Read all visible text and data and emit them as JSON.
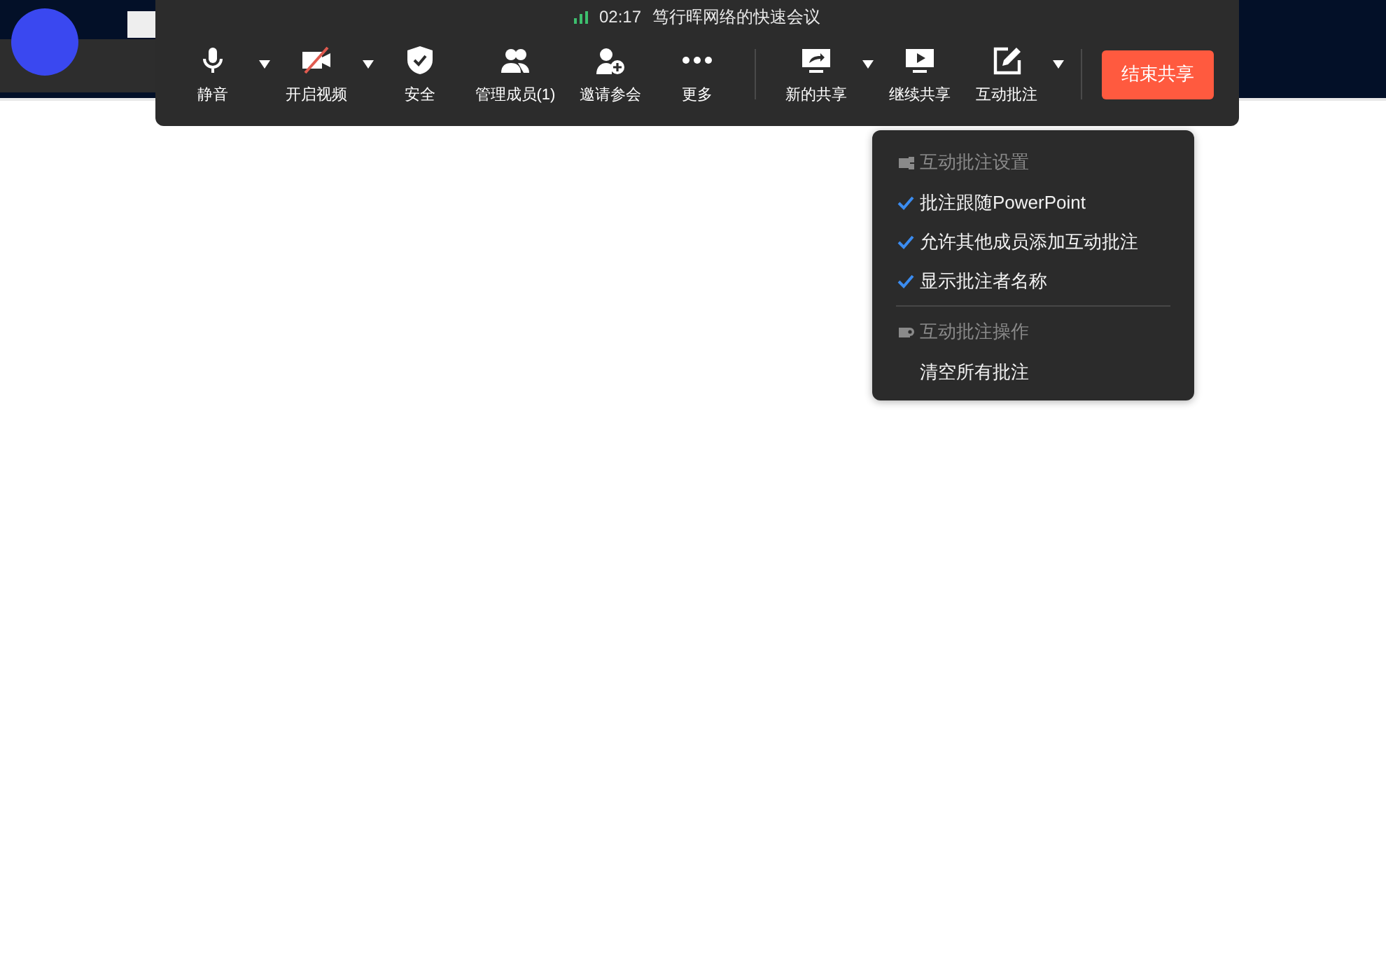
{
  "toolbar": {
    "status": {
      "time": "02:17",
      "title": "笃行晖网络的快速会议"
    },
    "buttons": [
      {
        "kind": "tool",
        "label": "静音",
        "has_menu": true
      },
      {
        "kind": "tool",
        "label": "开启视频",
        "has_menu": true
      },
      {
        "kind": "tool",
        "label": "安全",
        "has_menu": false
      },
      {
        "kind": "tool",
        "label": "管理成员(1)",
        "has_menu": false
      },
      {
        "kind": "tool",
        "label": "邀请参会",
        "has_menu": false
      },
      {
        "kind": "tool",
        "label": "更多",
        "has_menu": false
      },
      {
        "kind": "divider"
      },
      {
        "kind": "tool",
        "label": "新的共享",
        "has_menu": true
      },
      {
        "kind": "tool",
        "label": "继续共享",
        "has_menu": false
      },
      {
        "kind": "tool",
        "label": "互动批注",
        "has_menu": true
      },
      {
        "kind": "divider"
      },
      {
        "kind": "end",
        "label": "结束共享"
      }
    ]
  },
  "annotation_menu": {
    "sections": [
      {
        "header": "互动批注设置",
        "items": [
          {
            "label": "批注跟随PowerPoint",
            "checked": true
          },
          {
            "label": "允许其他成员添加互动批注",
            "checked": true
          },
          {
            "label": "显示批注者名称",
            "checked": true
          }
        ]
      },
      {
        "header": "互动批注操作",
        "items": [
          {
            "label": "清空所有批注",
            "checked": false
          }
        ]
      }
    ]
  }
}
